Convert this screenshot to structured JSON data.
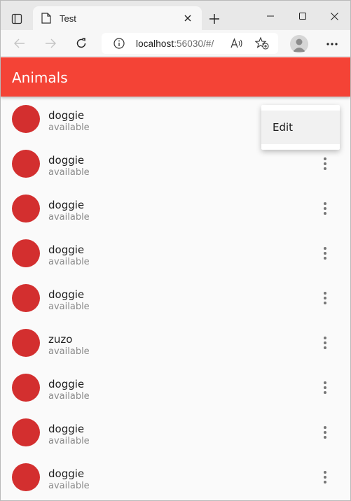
{
  "browser": {
    "tab_title": "Test",
    "url_host": "localhost",
    "url_rest": ":56030/#/",
    "icons": {
      "tab_actions": "tab-actions-icon",
      "favicon": "page-icon",
      "tab_close": "close-icon",
      "new_tab": "plus-icon",
      "minimize": "minimize-icon",
      "maximize": "maximize-icon",
      "close_window": "close-icon",
      "back": "arrow-left-icon",
      "forward": "arrow-right-icon",
      "reload": "reload-icon",
      "info": "info-icon",
      "read_aloud": "read-aloud-icon",
      "favorites": "star-add-icon",
      "profile": "profile-icon",
      "more": "more-horizontal-icon"
    }
  },
  "app": {
    "title": "Animals",
    "accent_color": "#f44336",
    "avatar_color": "#d32f2f"
  },
  "animals": [
    {
      "name": "doggie",
      "status": "available"
    },
    {
      "name": "doggie",
      "status": "available"
    },
    {
      "name": "doggie",
      "status": "available"
    },
    {
      "name": "doggie",
      "status": "available"
    },
    {
      "name": "doggie",
      "status": "available"
    },
    {
      "name": "zuzo",
      "status": "available"
    },
    {
      "name": "doggie",
      "status": "available"
    },
    {
      "name": "doggie",
      "status": "available"
    },
    {
      "name": "doggie",
      "status": "available"
    }
  ],
  "context_menu": {
    "items": [
      {
        "label": "Edit"
      }
    ]
  }
}
